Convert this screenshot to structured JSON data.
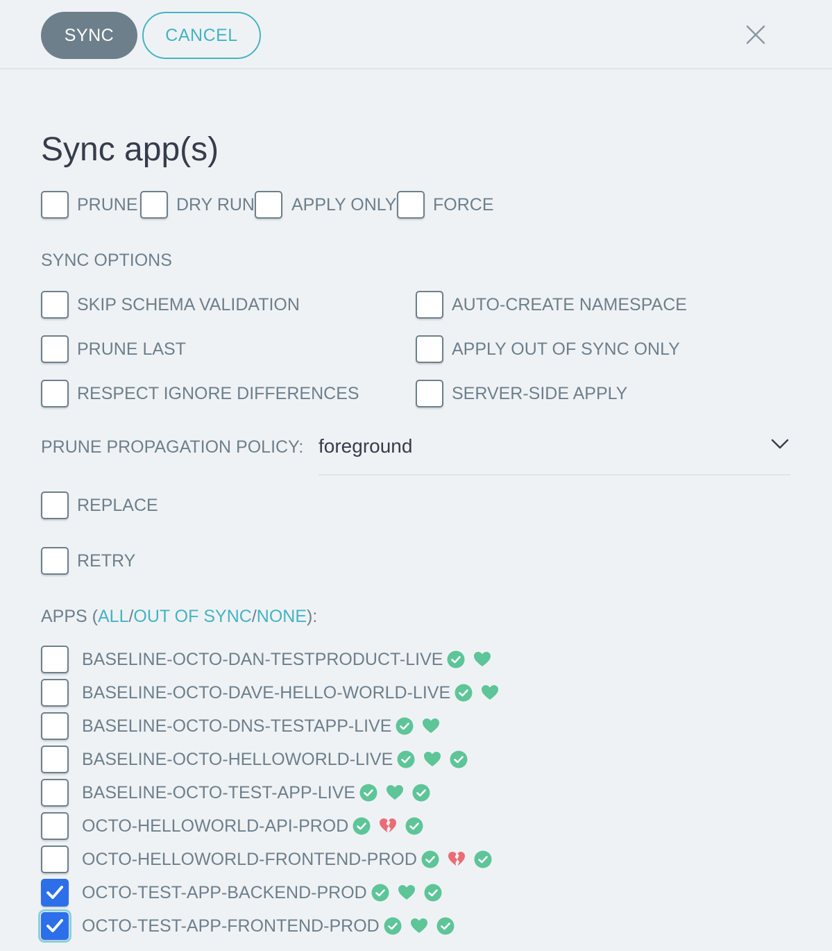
{
  "toolbar": {
    "sync_label": "SYNC",
    "cancel_label": "CANCEL"
  },
  "title": "Sync app(s)",
  "options": [
    "PRUNE",
    "DRY RUN",
    "APPLY ONLY",
    "FORCE"
  ],
  "sync_options": {
    "heading": "SYNC OPTIONS",
    "left": [
      "SKIP SCHEMA VALIDATION",
      "PRUNE LAST",
      "RESPECT IGNORE DIFFERENCES"
    ],
    "right": [
      "AUTO-CREATE NAMESPACE",
      "APPLY OUT OF SYNC ONLY",
      "SERVER-SIDE APPLY"
    ]
  },
  "prune_policy": {
    "label": "PRUNE PROPAGATION POLICY:",
    "value": "foreground"
  },
  "replace_label": "REPLACE",
  "retry_label": "RETRY",
  "apps_header": {
    "prefix": "APPS (",
    "all": "ALL",
    "out_of_sync": "OUT OF SYNC",
    "none": "NONE",
    "suffix": "):",
    "sep": "/"
  },
  "colors": {
    "healthy": "#5dc598",
    "degraded": "#e96d76",
    "checked": "#2c6fe8",
    "accent": "#44b3c2"
  },
  "apps": [
    {
      "name": "BASELINE-OCTO-DAN-TESTPRODUCT-LIVE",
      "checked": false,
      "icons": [
        "synced-check-icon",
        "healthy-heart-icon"
      ]
    },
    {
      "name": "BASELINE-OCTO-DAVE-HELLO-WORLD-LIVE",
      "checked": false,
      "icons": [
        "synced-check-icon",
        "healthy-heart-icon"
      ]
    },
    {
      "name": "BASELINE-OCTO-DNS-TESTAPP-LIVE",
      "checked": false,
      "icons": [
        "synced-check-icon",
        "healthy-heart-icon"
      ]
    },
    {
      "name": "BASELINE-OCTO-HELLOWORLD-LIVE",
      "checked": false,
      "icons": [
        "synced-check-icon",
        "healthy-heart-icon",
        "synced-check-icon"
      ]
    },
    {
      "name": "BASELINE-OCTO-TEST-APP-LIVE",
      "checked": false,
      "icons": [
        "synced-check-icon",
        "healthy-heart-icon",
        "synced-check-icon"
      ]
    },
    {
      "name": "OCTO-HELLOWORLD-API-PROD",
      "checked": false,
      "icons": [
        "synced-check-icon",
        "degraded-broken-heart-icon",
        "synced-check-icon"
      ]
    },
    {
      "name": "OCTO-HELLOWORLD-FRONTEND-PROD",
      "checked": false,
      "icons": [
        "synced-check-icon",
        "degraded-broken-heart-icon",
        "synced-check-icon"
      ]
    },
    {
      "name": "OCTO-TEST-APP-BACKEND-PROD",
      "checked": true,
      "icons": [
        "synced-check-icon",
        "healthy-heart-icon",
        "synced-check-icon"
      ]
    },
    {
      "name": "OCTO-TEST-APP-FRONTEND-PROD",
      "checked": true,
      "icons": [
        "synced-check-icon",
        "healthy-heart-icon",
        "synced-check-icon"
      ]
    }
  ]
}
